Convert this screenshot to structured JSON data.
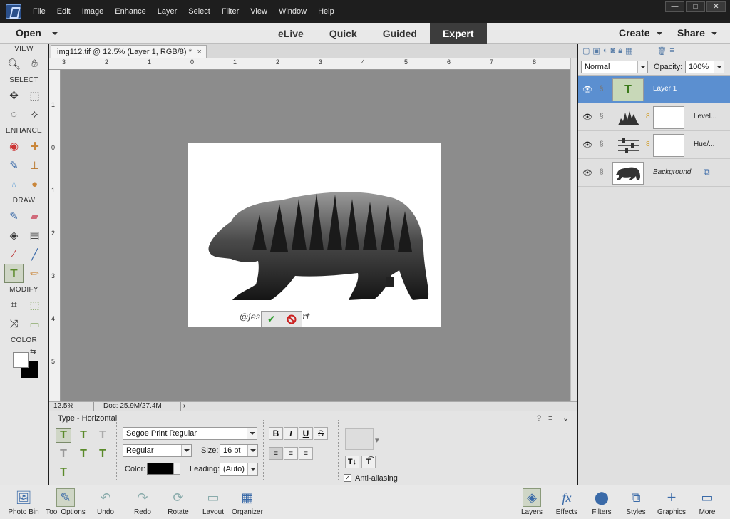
{
  "menubar": {
    "items": [
      "File",
      "Edit",
      "Image",
      "Enhance",
      "Layer",
      "Select",
      "Filter",
      "View",
      "Window",
      "Help"
    ],
    "window_buttons": [
      "—",
      "□",
      "✕"
    ]
  },
  "modebar": {
    "open_label": "Open",
    "modes": [
      "eLive",
      "Quick",
      "Guided",
      "Expert"
    ],
    "active_mode": "Expert",
    "create_label": "Create",
    "share_label": "Share"
  },
  "toolbox": {
    "sections": [
      "VIEW",
      "SELECT",
      "ENHANCE",
      "DRAW",
      "MODIFY",
      "COLOR"
    ],
    "active_tool": "horizontal-type-tool"
  },
  "document": {
    "tab_title": "img112.tif @ 12.5% (Layer 1, RGB/8) *",
    "close": "×",
    "watermark_text": "@jes",
    "watermark_tail": "rt",
    "commit": "✔",
    "cancel": "⃠"
  },
  "rulers": {
    "h_ticks": [
      "3",
      "2",
      "1",
      "0",
      "1",
      "2",
      "3",
      "4",
      "5",
      "6",
      "7",
      "8"
    ],
    "v_ticks": [
      "1",
      "0",
      "1",
      "2",
      "3",
      "4",
      "5"
    ]
  },
  "status": {
    "zoom": "12.5%",
    "doc": "Doc: 25.9M/27.4M"
  },
  "options": {
    "title": "Type - Horizontal",
    "font_family": "Segoe Print Regular",
    "font_style": "Regular",
    "size_label": "Size:",
    "size_value": "16 pt",
    "color_label": "Color:",
    "leading_label": "Leading:",
    "leading_value": "(Auto)",
    "bold": "B",
    "italic": "I",
    "underline": "U",
    "strike": "S",
    "anti_aliasing": "Anti-aliasing",
    "anti_aliasing_checked": true
  },
  "layers_panel": {
    "blend_mode": "Normal",
    "opacity_label": "Opacity:",
    "opacity_value": "100%",
    "layers": [
      {
        "name": "Layer 1",
        "selected": true
      },
      {
        "name": "Level...",
        "selected": false
      },
      {
        "name": "Hue/...",
        "selected": false
      },
      {
        "name": "Background",
        "selected": false
      }
    ]
  },
  "taskbar": {
    "left": [
      "Photo Bin",
      "Tool Options",
      "Undo",
      "Redo",
      "Rotate",
      "Layout",
      "Organizer"
    ],
    "right": [
      "Layers",
      "Effects",
      "Filters",
      "Styles",
      "Graphics",
      "More"
    ]
  }
}
